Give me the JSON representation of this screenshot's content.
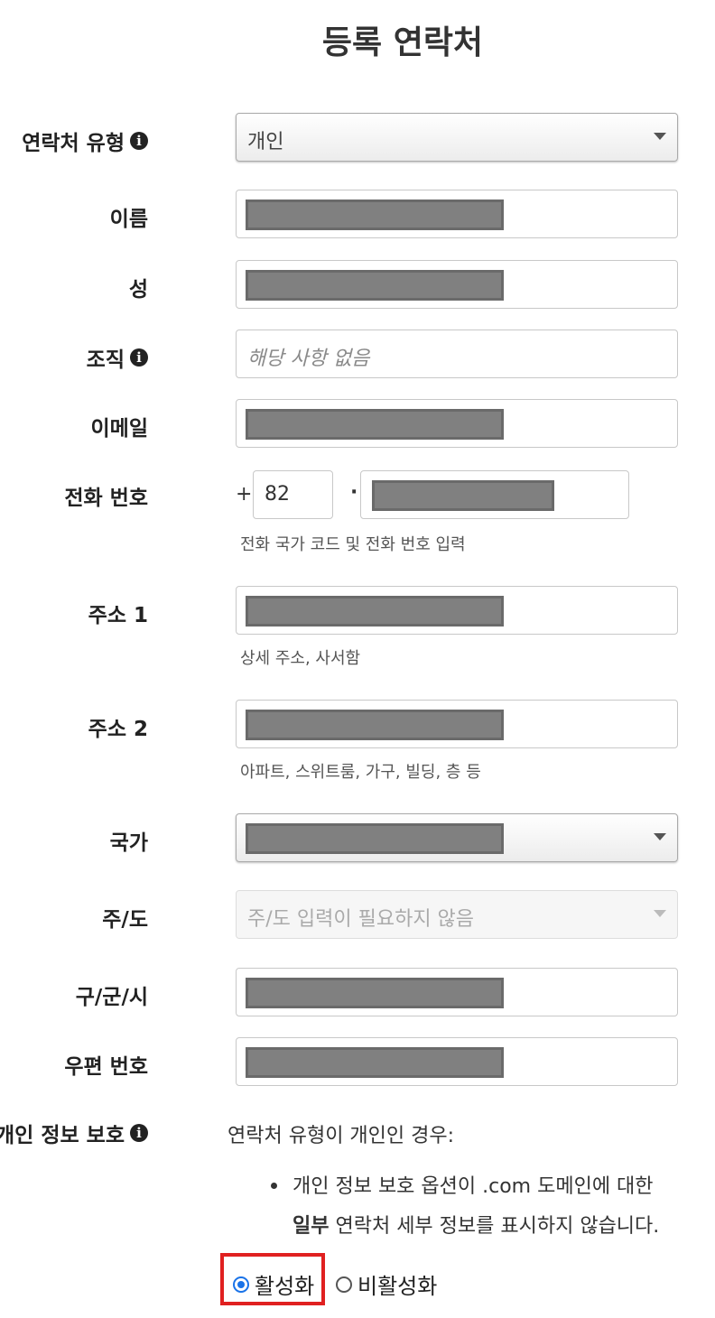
{
  "page": {
    "title": "등록 연락처"
  },
  "form": {
    "contact_type": {
      "label": "연락처 유형",
      "value": "개인"
    },
    "first_name": {
      "label": "이름"
    },
    "last_name": {
      "label": "성"
    },
    "organization": {
      "label": "조직",
      "placeholder": "해당 사항 없음"
    },
    "email": {
      "label": "이메일"
    },
    "phone": {
      "label": "전화 번호",
      "plus": "+",
      "country_code": "82",
      "separator": "·",
      "hint": "전화 국가 코드 및 전화 번호 입력"
    },
    "address1": {
      "label": "주소 1",
      "hint": "상세 주소, 사서함"
    },
    "address2": {
      "label": "주소 2",
      "hint": "아파트, 스위트룸, 가구, 빌딩, 층 등"
    },
    "country": {
      "label": "국가"
    },
    "state": {
      "label": "주/도",
      "value": "주/도 입력이 필요하지 않음"
    },
    "city": {
      "label": "구/군/시"
    },
    "postal_code": {
      "label": "우편 번호"
    }
  },
  "privacy": {
    "label": "개인 정보 보호",
    "intro": "연락처 유형이 개인인 경우:",
    "bullet_line1": "개인 정보 보호 옵션이 .com 도메인에 대한",
    "bullet_bold": "일부",
    "bullet_line2_rest": " 연락처 세부 정보를 표시하지 않습니다.",
    "options": {
      "enable": "활성화",
      "disable": "비활성화"
    },
    "selected": "enable"
  },
  "icons": {
    "info": "info-circle-icon",
    "caret": "chevron-down-icon"
  },
  "colors": {
    "highlight": "#e02020",
    "radio_selected": "#1a73e8",
    "redaction": "#808080"
  }
}
